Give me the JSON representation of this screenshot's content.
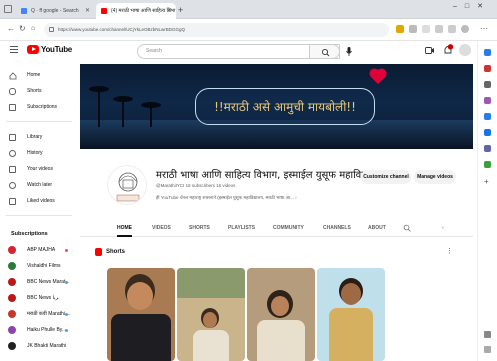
{
  "browser": {
    "tabs": [
      {
        "label": "Q · ff google - Search",
        "active": false
      },
      {
        "label": "(4) मराठी भाषा आणि साहित्य विभा",
        "active": true
      }
    ],
    "url": "https://www.youtube.com/channel/UCjYkLeOBzbNLwrBDGGgQ"
  },
  "youtube": {
    "logo_text": "YouTube",
    "search_placeholder": "Search"
  },
  "sidebar": {
    "main_items": [
      {
        "label": "Home",
        "icon": "home-icon"
      },
      {
        "label": "Shorts",
        "icon": "shorts-icon"
      },
      {
        "label": "Subscriptions",
        "icon": "subscriptions-icon"
      }
    ],
    "library_items": [
      {
        "label": "Library",
        "icon": "library-icon"
      },
      {
        "label": "History",
        "icon": "history-icon"
      },
      {
        "label": "Your videos",
        "icon": "your-videos-icon"
      },
      {
        "label": "Watch later",
        "icon": "watch-later-icon"
      },
      {
        "label": "Liked videos",
        "icon": "liked-icon"
      }
    ],
    "subscriptions_heading": "Subscriptions",
    "subscriptions": [
      {
        "label": "ABP MAJHA",
        "color": "#d9232e",
        "live": true
      },
      {
        "label": "Vishaldhi Films",
        "color": "#2c7a3a",
        "live": false
      },
      {
        "label": "BBC News Marat...",
        "color": "#bb1919",
        "live": true
      },
      {
        "label": "BBC News ﺮﺑﺎ",
        "color": "#bb1919",
        "live": false
      },
      {
        "label": "मराठी कवी Marathi ...",
        "color": "#c0392b",
        "live": true
      },
      {
        "label": "Haiku Phulle By...",
        "color": "#8e44ad",
        "live": true
      },
      {
        "label": "JK Bhakti Marathi",
        "color": "#222222",
        "live": false
      }
    ]
  },
  "banner": {
    "text": "!!मराठी असे आमुची मायबोली!!"
  },
  "channel": {
    "name": "मराठी भाषा आणि साहित्य विभाग, इस्माईल युसूफ महाविद्यालय",
    "meta": "@MarathiIYCI   16 subscribers   16 videos",
    "description": "ही YouTube चॅनल महाराष्ट्र शासनाने (इस्माईल युसूफ महाविद्यालय, मराठी भाषा आ...  ›",
    "customize_label": "Customize channel",
    "manage_label": "Manage videos"
  },
  "tabs": [
    "HOME",
    "VIDEOS",
    "SHORTS",
    "PLAYLISTS",
    "COMMUNITY",
    "CHANNELS",
    "ABOUT"
  ],
  "shorts": {
    "heading": "Shorts"
  },
  "colors": {
    "youtube_red": "#ff0000",
    "banner_bg": "#0b1b32",
    "banner_text": "#e8c878"
  }
}
